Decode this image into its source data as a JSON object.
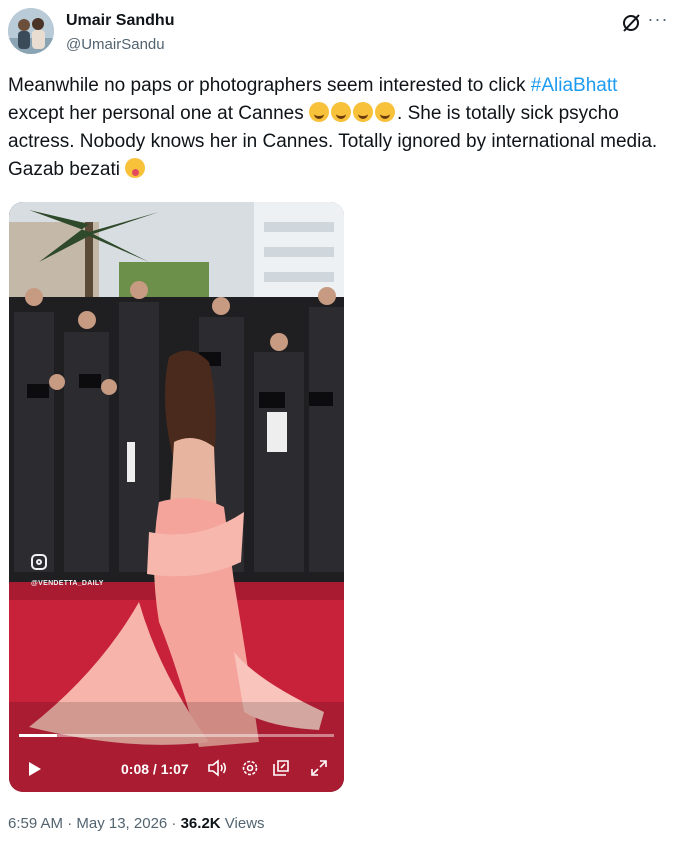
{
  "author": {
    "name": "Umair Sandhu",
    "handle": "@UmairSandu"
  },
  "tweet": {
    "text_part1": "Meanwhile no paps or photographers seem interested to click ",
    "hashtag": "#AliaBhatt",
    "text_part2": " except her personal one at Cannes ",
    "text_part3": ". She is totally sick psycho actress. Nobody knows her in Cannes. Totally ignored by international media. Gazab bezati ",
    "emojis_after_part2": [
      "rolling-on-floor-laughing",
      "rolling-on-floor-laughing",
      "rolling-on-floor-laughing",
      "rolling-on-floor-laughing"
    ],
    "emoji_end": "face-with-tongue"
  },
  "video": {
    "watermark": "@VENDETTA_DAILY",
    "time_display": "0:08 / 1:07",
    "progress_fraction": 0.12
  },
  "meta": {
    "timestamp": "6:59 AM · May 13, 2026 · ",
    "views_count": "36.2K",
    "views_label": " Views"
  },
  "icons": [
    "grok-icon",
    "more-icon",
    "play-icon",
    "volume-icon",
    "settings-icon",
    "pip-icon",
    "fullscreen-icon",
    "instagram-icon"
  ],
  "colors": {
    "link": "#1d9bf0",
    "secondary_text": "#536471",
    "carpet": "#c8223a",
    "dress": "#f4a49a"
  }
}
